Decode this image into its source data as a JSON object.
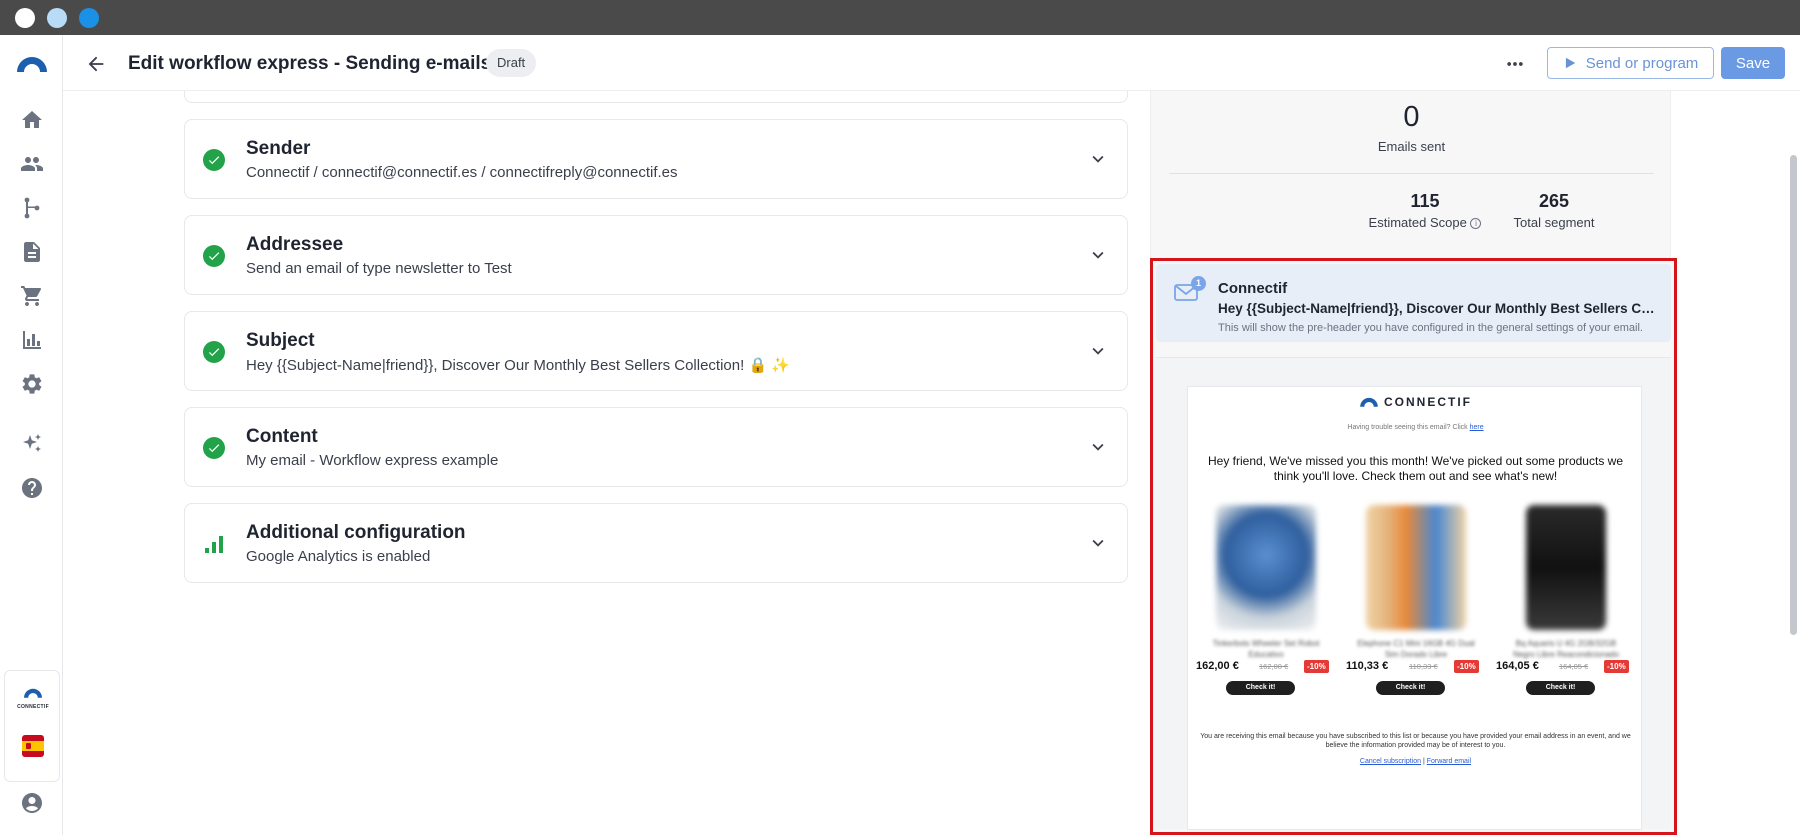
{
  "window": {
    "dots": [
      "#ffffff",
      "#b8dcf7",
      "#1a91e6"
    ]
  },
  "header": {
    "title": "Edit workflow express - Sending e-mails",
    "status_badge": "Draft",
    "send_label": "Send or program",
    "save_label": "Save"
  },
  "sidebar": {
    "items": [
      {
        "icon": "home-icon"
      },
      {
        "icon": "contacts-icon"
      },
      {
        "icon": "workflow-icon"
      },
      {
        "icon": "document-icon"
      },
      {
        "icon": "cart-icon"
      },
      {
        "icon": "bar-chart-icon"
      },
      {
        "icon": "gear-icon"
      },
      {
        "icon": "sparkles-icon"
      },
      {
        "icon": "help-icon"
      }
    ],
    "account_logo_text": "CONNECTIF",
    "language_flag": "es",
    "user_icon": "user-icon"
  },
  "cards": [
    {
      "title": "Sender",
      "subtitle": "Connectif / connectif@connectif.es / connectifreply@connectif.es",
      "status": "complete"
    },
    {
      "title": "Addressee",
      "subtitle": "Send an email of type newsletter to Test",
      "status": "complete"
    },
    {
      "title": "Subject",
      "subtitle": "Hey {{Subject-Name|friend}}, Discover Our Monthly Best Sellers Collection! 🔒 ✨",
      "status": "complete"
    },
    {
      "title": "Content",
      "subtitle": "My email - Workflow express example",
      "status": "complete"
    },
    {
      "title": "Additional configuration",
      "subtitle": "Google Analytics is enabled",
      "status": "analytics"
    }
  ],
  "stats": {
    "emails_sent_value": "0",
    "emails_sent_label": "Emails sent",
    "estimated_scope_value": "115",
    "estimated_scope_label": "Estimated Scope",
    "total_segment_value": "265",
    "total_segment_label": "Total segment"
  },
  "inbox_preview": {
    "badge_count": "1",
    "from": "Connectif",
    "subject": "Hey {{Subject-Name|friend}}, Discover Our Monthly Best Sellers Collection! 🔒 ✨",
    "preheader": "This will show the pre-header you have configured in the general settings of your email."
  },
  "email": {
    "logo_text": "CONNECTIF",
    "trouble_text": "Having trouble seeing this email? Click ",
    "trouble_link": "here",
    "intro": "Hey friend, We've missed you this month! We've picked out some products we think you'll love. Check them out and see what's new!",
    "products": [
      {
        "name": "Tinkerbots Wheeler Set Robot Educativo",
        "price": "162,00 €",
        "old_price": "162,00 €",
        "discount": "-10%",
        "button": "Check it!",
        "color": "#3a76b8"
      },
      {
        "name": "Elephone C1 Mini 16GB 4G Dual Sim Dorado Libre",
        "price": "110,33 €",
        "old_price": "110,33 €",
        "discount": "-10%",
        "button": "Check it!",
        "color": "#e0b27a"
      },
      {
        "name": "Bq Aquaris U 4G 2GB/32GB Negro Libre Reacondicionado",
        "price": "164,05 €",
        "old_price": "164,05 €",
        "discount": "-10%",
        "button": "Check it!",
        "color": "#222222"
      }
    ],
    "footer_text": "You are receiving this email because you have subscribed to this list or because you have provided your email address in an event, and we believe the information provided may be of interest to you.",
    "cancel_link": "Cancel subscription",
    "forward_link": "Forward email",
    "link_separator": " | "
  }
}
